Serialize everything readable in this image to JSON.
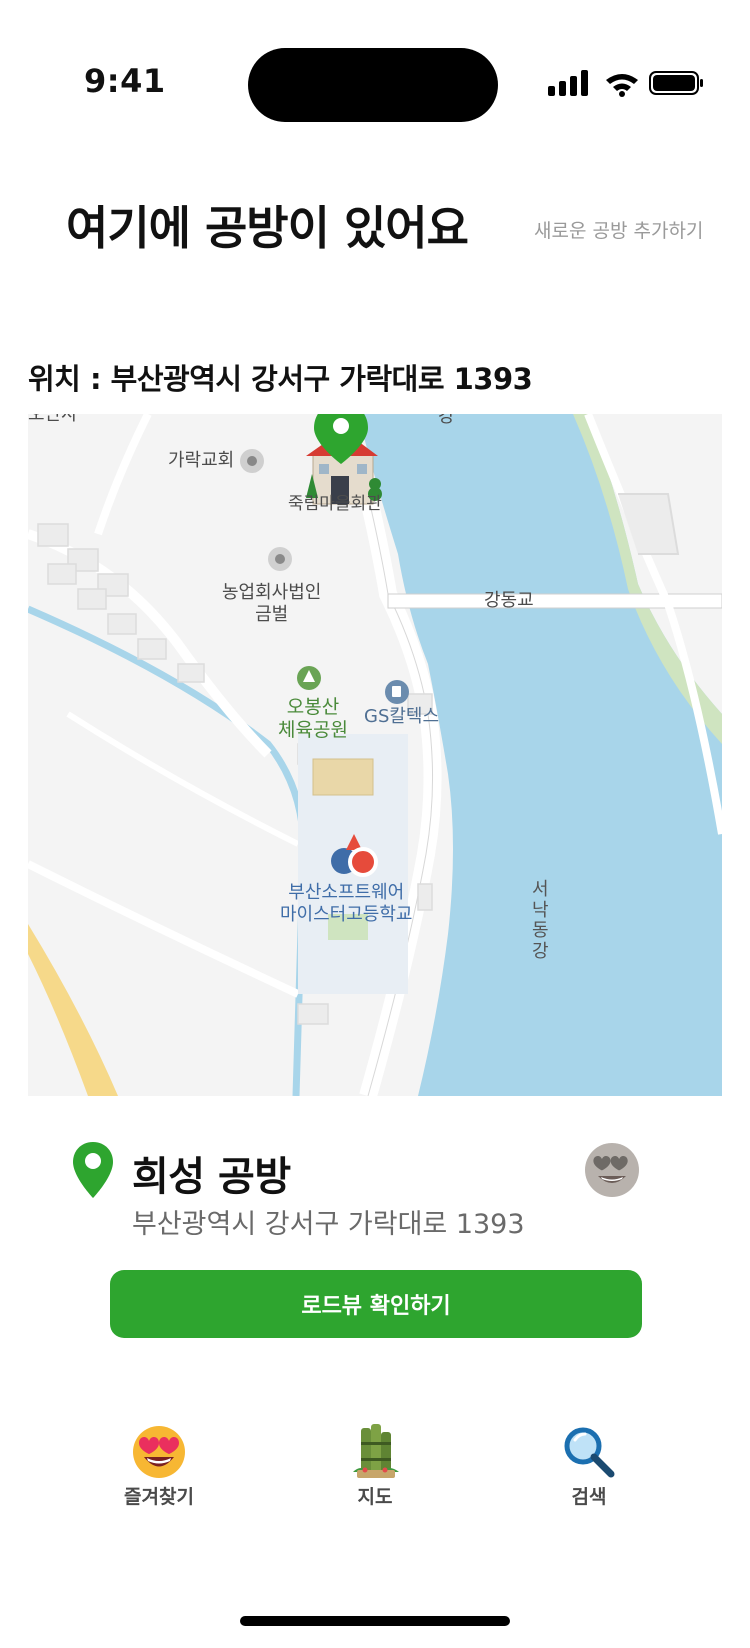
{
  "status_bar": {
    "time": "9:41"
  },
  "header": {
    "title": "여기에 공방이 있어요",
    "add_link": "새로운 공방 추가하기"
  },
  "location": {
    "label": "위치 : 부산광역시 강서구 가락대로 1393"
  },
  "map": {
    "labels": {
      "church": "가락교회",
      "hall": "죽림마을회관",
      "agri_1": "농업회사법인",
      "agri_2": "금벌",
      "bridge": "강동교",
      "park_1": "오봉산",
      "park_2": "체육공원",
      "gas": "GS칼텍스",
      "school_1": "부산소프트웨어",
      "school_2": "마이스터고등학교",
      "river_1": "서",
      "river_2": "낙",
      "river_3": "동",
      "river_4": "강",
      "top_left": "오단사",
      "top_river": "강"
    },
    "colors": {
      "water": "#a8d5ea",
      "land": "#f4f4f4",
      "road": "#ffffff",
      "park": "#cfe4c0",
      "highway": "#f6d98a"
    }
  },
  "shop": {
    "name": "희성 공방",
    "address": "부산광역시 강서구 가락대로 1393"
  },
  "actions": {
    "roadview": "로드뷰 확인하기"
  },
  "tabs": [
    {
      "label": "즐겨찾기",
      "icon": "heart-eyes-icon"
    },
    {
      "label": "지도",
      "icon": "bamboo-icon"
    },
    {
      "label": "검색",
      "icon": "magnifier-icon"
    }
  ],
  "accent_color": "#2ea52f"
}
